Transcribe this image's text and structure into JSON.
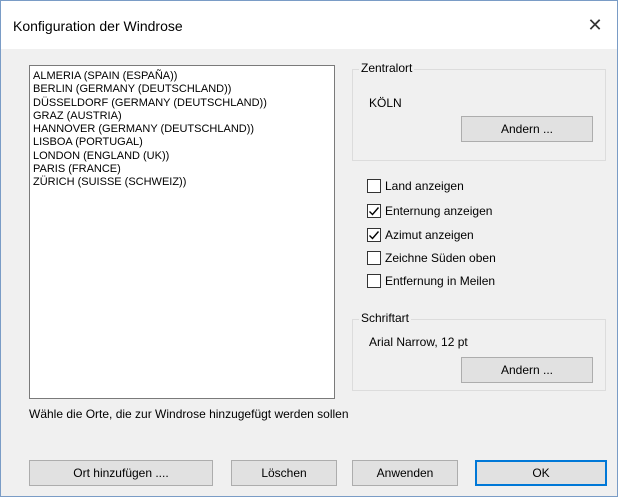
{
  "window": {
    "title": "Konfiguration der Windrose",
    "close_glyph": "✕"
  },
  "cities": [
    "ALMERIA (SPAIN (ESPAÑA))",
    "BERLIN (GERMANY (DEUTSCHLAND))",
    "DÜSSELDORF (GERMANY (DEUTSCHLAND))",
    "GRAZ (AUSTRIA)",
    "HANNOVER (GERMANY (DEUTSCHLAND))",
    "LISBOA (PORTUGAL)",
    "LONDON (ENGLAND (UK))",
    "PARIS (FRANCE)",
    "ZÜRICH (SUISSE (SCHWEIZ))"
  ],
  "hint": "Wähle die Orte, die zur Windrose hinzugefügt werden sollen",
  "zentralort": {
    "label": "Zentralort",
    "value": "KÖLN",
    "button": "Andern ..."
  },
  "options": [
    {
      "label": "Land anzeigen",
      "checked": false
    },
    {
      "label": "Enternung anzeigen",
      "checked": true
    },
    {
      "label": "Azimut anzeigen",
      "checked": true
    },
    {
      "label": "Zeichne Süden oben",
      "checked": false
    },
    {
      "label": "Entfernung in Meilen",
      "checked": false
    }
  ],
  "schriftart": {
    "label": "Schriftart",
    "value": "Arial Narrow, 12 pt",
    "button": "Andern ..."
  },
  "buttons": {
    "add": "Ort hinzufügen ....",
    "delete": "Löschen",
    "apply": "Anwenden",
    "ok": "OK"
  },
  "colors": {
    "accent": "#0078d7",
    "background": "#f0f0f0"
  }
}
